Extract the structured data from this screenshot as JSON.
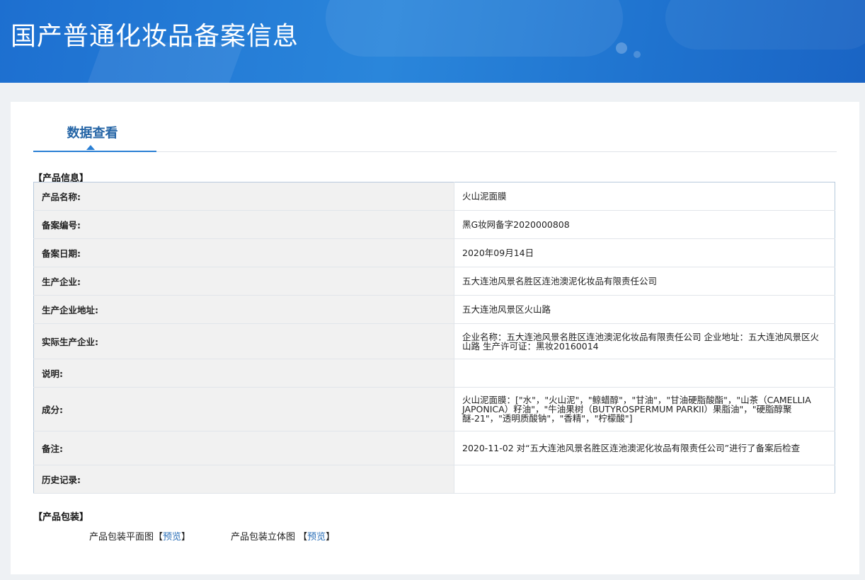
{
  "banner": {
    "title": "国产普通化妆品备案信息"
  },
  "tab": {
    "label": "数据查看"
  },
  "product_info": {
    "section_title": "【产品信息】",
    "rows": [
      {
        "label": "产品名称:",
        "value": "火山泥面膜"
      },
      {
        "label": "备案编号:",
        "value": "黑G妆网备字2020000808"
      },
      {
        "label": "备案日期:",
        "value": "2020年09月14日"
      },
      {
        "label": "生产企业:",
        "value": "五大连池风景名胜区连池澳泥化妆品有限责任公司"
      },
      {
        "label": "生产企业地址:",
        "value": "五大连池风景区火山路"
      },
      {
        "label": "实际生产企业:",
        "value": "企业名称：五大连池风景名胜区连池澳泥化妆品有限责任公司 企业地址：五大连池风景区火山路 生产许可证：黑妆20160014"
      },
      {
        "label": "说明:",
        "value": ""
      },
      {
        "label": "成分:",
        "value": "火山泥面膜：[\"水\"，\"火山泥\"，\"鲸蜡醇\"，\"甘油\"，\"甘油硬脂酸酯\"，\"山茶（CAMELLIA JAPONICA）籽油\"，\"牛油果树（BUTYROSPERMUM PARKII）果脂油\"，\"硬脂醇聚醚-21\"，\"透明质酸钠\"，\"香精\"，\"柠檬酸\"]"
      },
      {
        "label": "备注:",
        "value": "2020-11-02 对“五大连池风景名胜区连池澳泥化妆品有限责任公司”进行了备案后检查"
      },
      {
        "label": "历史记录:",
        "value": ""
      }
    ]
  },
  "packaging": {
    "section_title": "【产品包装】",
    "flat": {
      "label": "产品包装平面图",
      "open": "【",
      "link": "预览",
      "close": "】"
    },
    "three_d": {
      "label": "产品包装立体图 ",
      "open": "【",
      "link": "预览",
      "close": "】"
    }
  }
}
